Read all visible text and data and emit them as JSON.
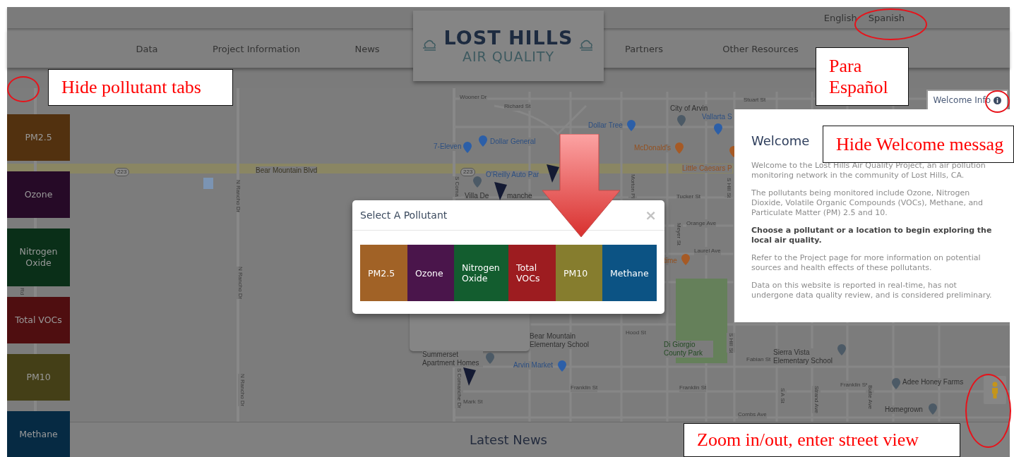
{
  "language_links": [
    "English",
    "Spanish"
  ],
  "nav": [
    "Data",
    "Project Information",
    "News",
    "Partners",
    "Other Resources"
  ],
  "logo": {
    "title": "LOST HILLS",
    "subtitle": "AIR QUALITY"
  },
  "pollutant_tabs": [
    {
      "label": "PM2.5",
      "color": "#52310f"
    },
    {
      "label": "Ozone",
      "color": "#260a27"
    },
    {
      "label": "Nitrogen Oxide",
      "color": "#0a2f18"
    },
    {
      "label": "Total VOCs",
      "color": "#4f0e10"
    },
    {
      "label": "PM10",
      "color": "#443f17"
    },
    {
      "label": "Methane",
      "color": "#062a43"
    }
  ],
  "map": {
    "labels": [
      {
        "text": "Wooner Dr",
        "kind": "street"
      },
      {
        "text": "Richard St",
        "kind": "street"
      },
      {
        "text": "Stuart St",
        "kind": "street"
      },
      {
        "text": "City of Arvin",
        "kind": "place"
      },
      {
        "text": "Vallarta S",
        "kind": "poi"
      },
      {
        "text": "Dollar Tree",
        "kind": "poi"
      },
      {
        "text": "7-Eleven",
        "kind": "poi"
      },
      {
        "text": "Dollar General",
        "kind": "poi"
      },
      {
        "text": "McDonald's",
        "kind": "food"
      },
      {
        "text": "Bear Mountain Blvd",
        "kind": "road"
      },
      {
        "text": "Little Caesars P",
        "kind": "food"
      },
      {
        "text": "O'Reilly Auto Par",
        "kind": "poi"
      },
      {
        "text": "Villa De",
        "kind": "place"
      },
      {
        "text": "manche",
        "kind": "place"
      },
      {
        "text": "Tucker St",
        "kind": "street"
      },
      {
        "text": "Orange Ave",
        "kind": "street"
      },
      {
        "text": "Laurel Ave",
        "kind": "street"
      },
      {
        "text": "time",
        "kind": "food"
      },
      {
        "text": "Hood St",
        "kind": "street"
      },
      {
        "text": "Bear Mountain Elementary School",
        "kind": "place"
      },
      {
        "text": "Di Giorgio County Park",
        "kind": "park"
      },
      {
        "text": "Fabian St",
        "kind": "street"
      },
      {
        "text": "Sierra Vista Elementary School",
        "kind": "place"
      },
      {
        "text": "Arvin Market",
        "kind": "poi"
      },
      {
        "text": "Franklin St",
        "kind": "street"
      },
      {
        "text": "Franklin St",
        "kind": "street"
      },
      {
        "text": "Franklin St",
        "kind": "street"
      },
      {
        "text": "Adee Honey Farms",
        "kind": "place"
      },
      {
        "text": "Homegrown",
        "kind": "place"
      },
      {
        "text": "Combs Ave",
        "kind": "street"
      },
      {
        "text": "Summerset Apartment Homes",
        "kind": "place"
      },
      {
        "text": "Mark St",
        "kind": "street"
      },
      {
        "text": "N Rancho Dr",
        "kind": "street_vertical"
      },
      {
        "text": "N Rancho Dr",
        "kind": "street_vertical"
      },
      {
        "text": "N Rancho Dr",
        "kind": "street_vertical"
      },
      {
        "text": "S Coma",
        "kind": "street_vertical"
      },
      {
        "text": "S Comanche Dr",
        "kind": "street_vertical"
      },
      {
        "text": "Morton Pl",
        "kind": "street_vertical"
      },
      {
        "text": "S Hill St",
        "kind": "street_vertical"
      },
      {
        "text": "Meyer St",
        "kind": "street_vertical"
      },
      {
        "text": "S Hill St",
        "kind": "street_vertical"
      },
      {
        "text": "S A St",
        "kind": "street_vertical"
      },
      {
        "text": "Strand Ave",
        "kind": "street_vertical"
      },
      {
        "text": "Butte Ave",
        "kind": "street_vertical"
      },
      {
        "text": "Rd",
        "kind": "street_vertical"
      }
    ],
    "route_shields": [
      "223",
      "223"
    ]
  },
  "welcome_info_button": {
    "label": "Welcome Info"
  },
  "welcome_panel": {
    "title": "Welcome",
    "paragraphs": [
      {
        "text": "Welcome to the Lost Hills Air Quality Project, an air pollution monitoring network in the community of Lost Hills, CA.",
        "kind": "normal"
      },
      {
        "text": "The pollutants being monitored include Ozone, Nitrogen Dioxide, Volatile Organic Compounds (VOCs), Methane, and Particulate Matter (PM) 2.5 and 10.",
        "kind": "normal"
      },
      {
        "text": "Choose a pollutant or a location to begin exploring the local air quality.",
        "kind": "emphasis"
      },
      {
        "text": "Refer to the Project page for more information on potential sources and health effects of these pollutants.",
        "kind": "normal"
      },
      {
        "text": "Data on this website is reported in real-time, has not undergone data quality review, and is considered preliminary.",
        "kind": "normal"
      }
    ]
  },
  "modal": {
    "title": "Select A Pollutant",
    "close": "×",
    "options": [
      {
        "label": "PM2.5",
        "color": "#a16226"
      },
      {
        "label": "Ozone",
        "color": "#4a154b"
      },
      {
        "label": "Nitrogen Oxide",
        "color": "#135d2f"
      },
      {
        "label": "Total VOCs",
        "color": "#9d1c20"
      },
      {
        "label": "PM10",
        "color": "#867d2e"
      },
      {
        "label": "Methane",
        "color": "#0c5384"
      }
    ]
  },
  "latest_news": {
    "title": "Latest News"
  },
  "annotations": [
    {
      "text": "Hide pollutant tabs"
    },
    {
      "text": "Para Español"
    },
    {
      "text": "Hide Welcome messag"
    },
    {
      "text": "Zoom in/out, enter street view"
    }
  ]
}
